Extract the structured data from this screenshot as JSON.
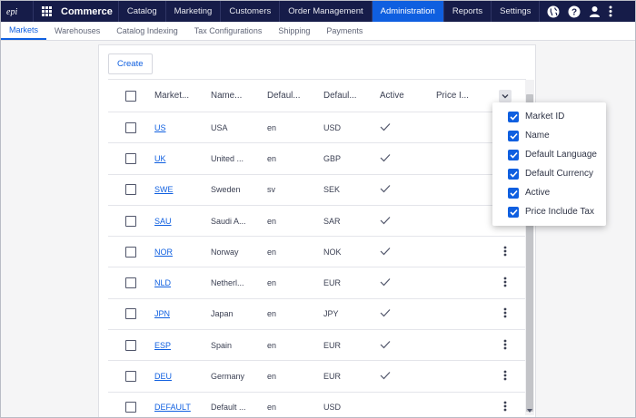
{
  "topnav": {
    "brand": "Commerce",
    "items": [
      {
        "label": "Catalog"
      },
      {
        "label": "Marketing"
      },
      {
        "label": "Customers"
      },
      {
        "label": "Order Management"
      },
      {
        "label": "Administration"
      },
      {
        "label": "Reports"
      },
      {
        "label": "Settings"
      }
    ],
    "active": "Administration",
    "icons": [
      "globe-icon",
      "help-icon",
      "user-icon",
      "more-vertical-icon"
    ],
    "bg_color": "#161c49",
    "accent_color": "#0f5fe0"
  },
  "subnav": {
    "items": [
      {
        "label": "Markets"
      },
      {
        "label": "Warehouses"
      },
      {
        "label": "Catalog Indexing"
      },
      {
        "label": "Tax Configurations"
      },
      {
        "label": "Shipping"
      },
      {
        "label": "Payments"
      }
    ],
    "active": "Markets"
  },
  "toolbar": {
    "create_label": "Create"
  },
  "table": {
    "headers": {
      "market_id": "Market...",
      "name": "Name...",
      "language": "Defaul...",
      "currency": "Defaul...",
      "active": "Active",
      "price_include_tax": "Price I..."
    },
    "rows": [
      {
        "id": "US",
        "name": "USA",
        "lang": "en",
        "currency": "USD",
        "active": true,
        "menu": false
      },
      {
        "id": "UK",
        "name": "United ...",
        "lang": "en",
        "currency": "GBP",
        "active": true,
        "menu": false
      },
      {
        "id": "SWE",
        "name": "Sweden",
        "lang": "sv",
        "currency": "SEK",
        "active": true,
        "menu": false
      },
      {
        "id": "SAU",
        "name": "Saudi A...",
        "lang": "en",
        "currency": "SAR",
        "active": true,
        "menu": false
      },
      {
        "id": "NOR",
        "name": "Norway",
        "lang": "en",
        "currency": "NOK",
        "active": true,
        "menu": true
      },
      {
        "id": "NLD",
        "name": "Netherl...",
        "lang": "en",
        "currency": "EUR",
        "active": true,
        "menu": true
      },
      {
        "id": "JPN",
        "name": "Japan",
        "lang": "en",
        "currency": "JPY",
        "active": true,
        "menu": true
      },
      {
        "id": "ESP",
        "name": "Spain",
        "lang": "en",
        "currency": "EUR",
        "active": true,
        "menu": true
      },
      {
        "id": "DEU",
        "name": "Germany",
        "lang": "en",
        "currency": "EUR",
        "active": true,
        "menu": true
      },
      {
        "id": "DEFAULT",
        "name": "Default ...",
        "lang": "en",
        "currency": "USD",
        "active": false,
        "menu": true
      }
    ]
  },
  "column_chooser": {
    "items": [
      {
        "label": "Market ID",
        "checked": true
      },
      {
        "label": "Name",
        "checked": true
      },
      {
        "label": "Default Language",
        "checked": true
      },
      {
        "label": "Default Currency",
        "checked": true
      },
      {
        "label": "Active",
        "checked": true
      },
      {
        "label": "Price Include Tax",
        "checked": true
      }
    ]
  }
}
